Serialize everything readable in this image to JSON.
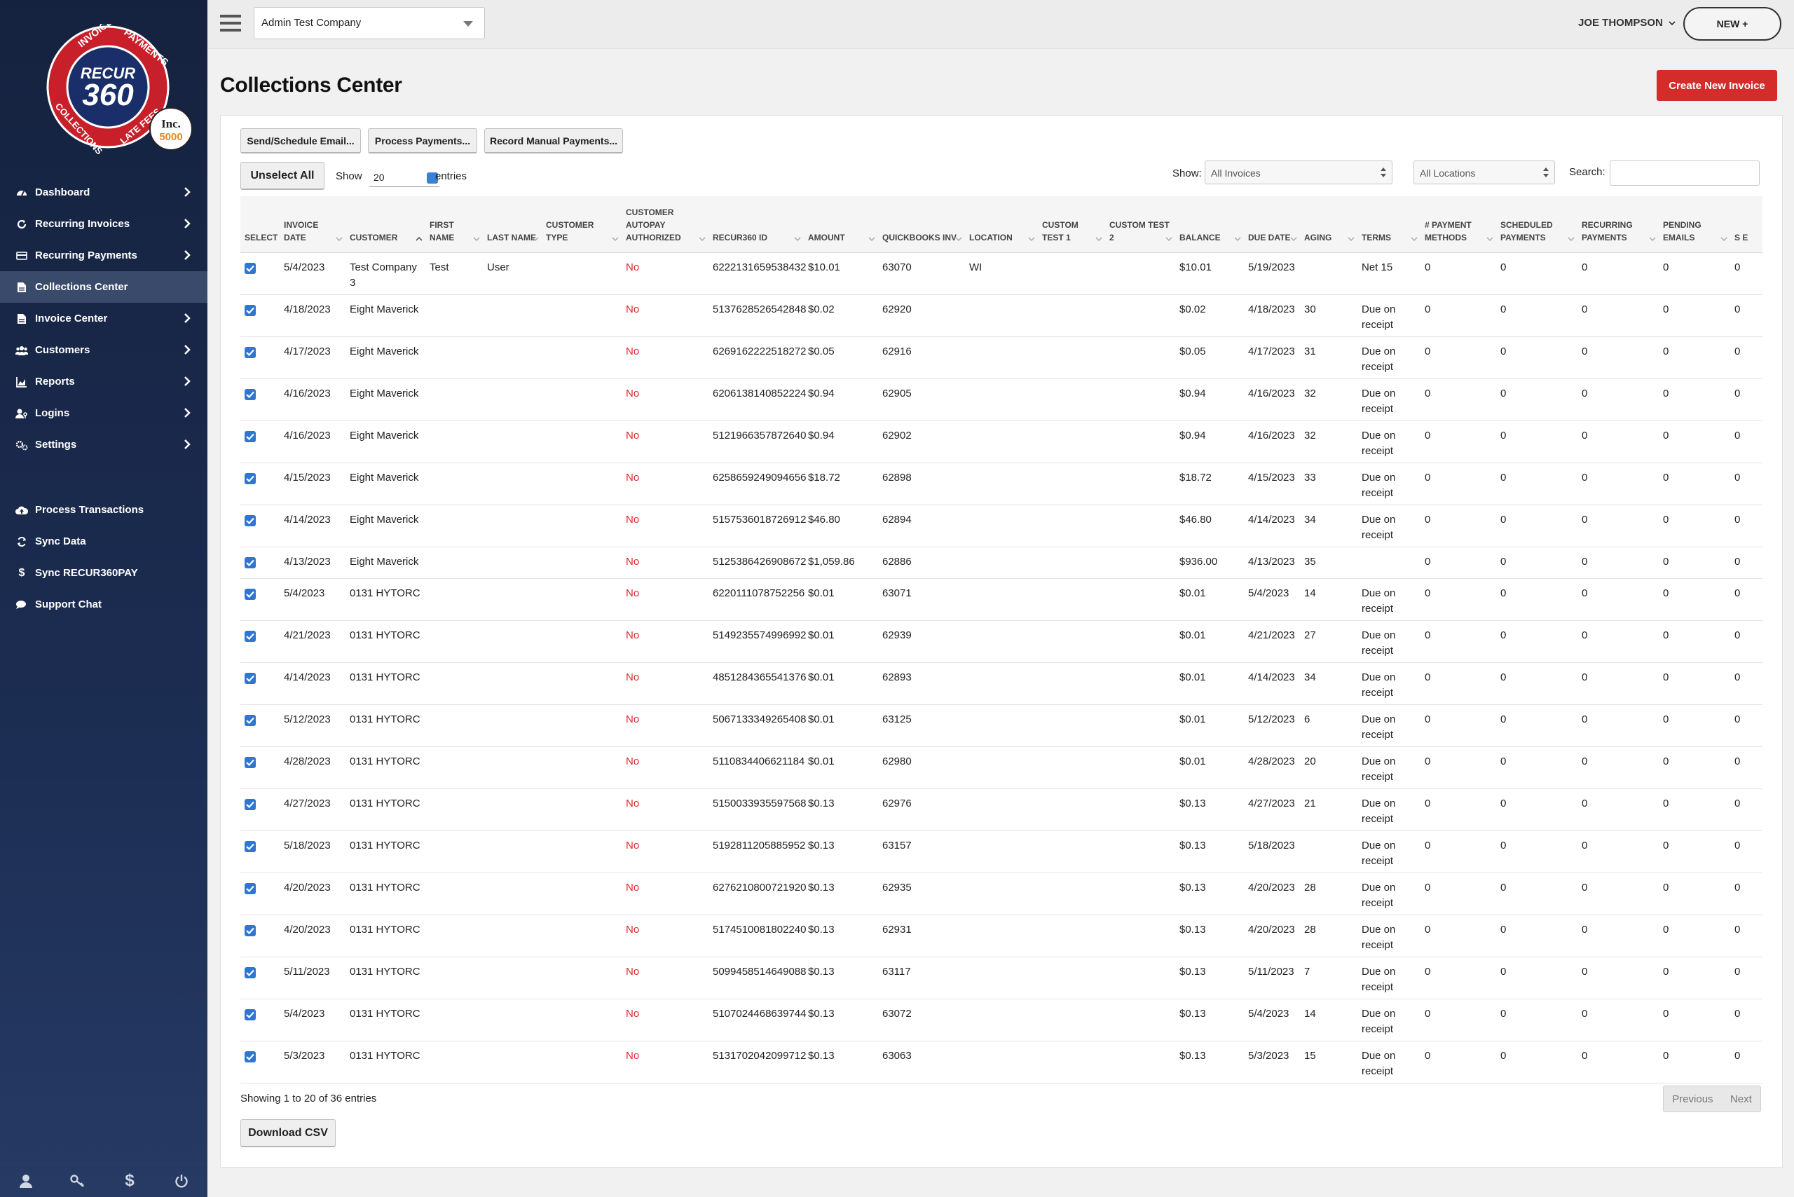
{
  "brand": {
    "logo_text_main": "RECUR",
    "logo_text_num": "360",
    "ring_words": [
      "INVOICES",
      "PAYMENTS",
      "LATE FEES",
      "COLLECTIONS"
    ],
    "badge_line1": "Inc.",
    "badge_line2": "5000"
  },
  "sidebar": {
    "items": [
      {
        "label": "Dashboard",
        "icon": "dashboard-icon",
        "chevron": true
      },
      {
        "label": "Recurring Invoices",
        "icon": "refresh-icon",
        "chevron": true
      },
      {
        "label": "Recurring Payments",
        "icon": "credit-card-icon",
        "chevron": true
      },
      {
        "label": "Collections Center",
        "icon": "file-icon",
        "chevron": false,
        "active": true
      },
      {
        "label": "Invoice Center",
        "icon": "file-icon",
        "chevron": true
      },
      {
        "label": "Customers",
        "icon": "users-icon",
        "chevron": true
      },
      {
        "label": "Reports",
        "icon": "chart-icon",
        "chevron": true
      },
      {
        "label": "Logins",
        "icon": "user-key-icon",
        "chevron": true
      },
      {
        "label": "Settings",
        "icon": "gears-icon",
        "chevron": true
      }
    ],
    "secondary": [
      {
        "label": "Process Transactions",
        "icon": "cloud-upload-icon"
      },
      {
        "label": "Sync Data",
        "icon": "sync-icon"
      },
      {
        "label": "Sync RECUR360PAY",
        "icon": "dollar-icon"
      },
      {
        "label": "Support Chat",
        "icon": "chat-icon"
      }
    ],
    "footer_icons": [
      "user-icon",
      "key-icon",
      "dollar-icon",
      "power-icon"
    ]
  },
  "topbar": {
    "company": "Admin Test Company",
    "user": "JOE THOMPSON",
    "new_label": "NEW +"
  },
  "page": {
    "title": "Collections Center",
    "create_label": "Create New Invoice"
  },
  "toolbar": {
    "send_email": "Send/Schedule Email...",
    "process_payments": "Process Payments...",
    "record_manual": "Record Manual Payments...",
    "unselect_all": "Unselect All",
    "show": "Show",
    "entries_value": "20",
    "entries": "entries",
    "show_filter_label": "Show:",
    "invoice_filter": "All Invoices",
    "location_filter": "All Locations",
    "search_label": "Search:"
  },
  "table": {
    "headers": [
      "SELECT",
      "INVOICE DATE",
      "CUSTOMER",
      "FIRST NAME",
      "LAST NAME",
      "CUSTOMER TYPE",
      "CUSTOMER AUTOPAY AUTHORIZED",
      "RECUR360 ID",
      "AMOUNT",
      "QUICKBOOKS INV",
      "LOCATION",
      "CUSTOM TEST 1",
      "CUSTOM TEST 2",
      "BALANCE",
      "DUE DATE",
      "AGING",
      "TERMS",
      "# PAYMENT METHODS",
      "SCHEDULED PAYMENTS",
      "RECURRING PAYMENTS",
      "PENDING EMAILS",
      "S E"
    ],
    "rows": [
      {
        "date": "5/4/2023",
        "customer": "Test Company 3",
        "first": "Test",
        "last": "User",
        "ctype": "",
        "autopay": "No",
        "id": "6222131659538432",
        "amount": "$10.01",
        "qb": "63070",
        "location": "WI",
        "c1": "",
        "c2": "",
        "balance": "$10.01",
        "due": "5/19/2023",
        "aging": "",
        "terms": "Net 15",
        "pm": "0",
        "sp": "0",
        "rp": "0",
        "pe": "0",
        "se": "0"
      },
      {
        "date": "4/18/2023",
        "customer": "Eight Maverick",
        "first": "",
        "last": "",
        "ctype": "",
        "autopay": "No",
        "id": "5137628526542848",
        "amount": "$0.02",
        "qb": "62920",
        "location": "",
        "c1": "",
        "c2": "",
        "balance": "$0.02",
        "due": "4/18/2023",
        "aging": "30",
        "terms": "Due on receipt",
        "pm": "0",
        "sp": "0",
        "rp": "0",
        "pe": "0",
        "se": "0"
      },
      {
        "date": "4/17/2023",
        "customer": "Eight Maverick",
        "first": "",
        "last": "",
        "ctype": "",
        "autopay": "No",
        "id": "6269162222518272",
        "amount": "$0.05",
        "qb": "62916",
        "location": "",
        "c1": "",
        "c2": "",
        "balance": "$0.05",
        "due": "4/17/2023",
        "aging": "31",
        "terms": "Due on receipt",
        "pm": "0",
        "sp": "0",
        "rp": "0",
        "pe": "0",
        "se": "0"
      },
      {
        "date": "4/16/2023",
        "customer": "Eight Maverick",
        "first": "",
        "last": "",
        "ctype": "",
        "autopay": "No",
        "id": "6206138140852224",
        "amount": "$0.94",
        "qb": "62905",
        "location": "",
        "c1": "",
        "c2": "",
        "balance": "$0.94",
        "due": "4/16/2023",
        "aging": "32",
        "terms": "Due on receipt",
        "pm": "0",
        "sp": "0",
        "rp": "0",
        "pe": "0",
        "se": "0"
      },
      {
        "date": "4/16/2023",
        "customer": "Eight Maverick",
        "first": "",
        "last": "",
        "ctype": "",
        "autopay": "No",
        "id": "5121966357872640",
        "amount": "$0.94",
        "qb": "62902",
        "location": "",
        "c1": "",
        "c2": "",
        "balance": "$0.94",
        "due": "4/16/2023",
        "aging": "32",
        "terms": "Due on receipt",
        "pm": "0",
        "sp": "0",
        "rp": "0",
        "pe": "0",
        "se": "0"
      },
      {
        "date": "4/15/2023",
        "customer": "Eight Maverick",
        "first": "",
        "last": "",
        "ctype": "",
        "autopay": "No",
        "id": "6258659249094656",
        "amount": "$18.72",
        "qb": "62898",
        "location": "",
        "c1": "",
        "c2": "",
        "balance": "$18.72",
        "due": "4/15/2023",
        "aging": "33",
        "terms": "Due on receipt",
        "pm": "0",
        "sp": "0",
        "rp": "0",
        "pe": "0",
        "se": "0"
      },
      {
        "date": "4/14/2023",
        "customer": "Eight Maverick",
        "first": "",
        "last": "",
        "ctype": "",
        "autopay": "No",
        "id": "5157536018726912",
        "amount": "$46.80",
        "qb": "62894",
        "location": "",
        "c1": "",
        "c2": "",
        "balance": "$46.80",
        "due": "4/14/2023",
        "aging": "34",
        "terms": "Due on receipt",
        "pm": "0",
        "sp": "0",
        "rp": "0",
        "pe": "0",
        "se": "0"
      },
      {
        "date": "4/13/2023",
        "customer": "Eight Maverick",
        "first": "",
        "last": "",
        "ctype": "",
        "autopay": "No",
        "id": "5125386426908672",
        "amount": "$1,059.86",
        "qb": "62886",
        "location": "",
        "c1": "",
        "c2": "",
        "balance": "$936.00",
        "due": "4/13/2023",
        "aging": "35",
        "terms": "",
        "pm": "0",
        "sp": "0",
        "rp": "0",
        "pe": "0",
        "se": "0"
      },
      {
        "date": "5/4/2023",
        "customer": "0131 HYTORC",
        "first": "",
        "last": "",
        "ctype": "",
        "autopay": "No",
        "id": "6220111078752256",
        "amount": "$0.01",
        "qb": "63071",
        "location": "",
        "c1": "",
        "c2": "",
        "balance": "$0.01",
        "due": "5/4/2023",
        "aging": "14",
        "terms": "Due on receipt",
        "pm": "0",
        "sp": "0",
        "rp": "0",
        "pe": "0",
        "se": "0"
      },
      {
        "date": "4/21/2023",
        "customer": "0131 HYTORC",
        "first": "",
        "last": "",
        "ctype": "",
        "autopay": "No",
        "id": "5149235574996992",
        "amount": "$0.01",
        "qb": "62939",
        "location": "",
        "c1": "",
        "c2": "",
        "balance": "$0.01",
        "due": "4/21/2023",
        "aging": "27",
        "terms": "Due on receipt",
        "pm": "0",
        "sp": "0",
        "rp": "0",
        "pe": "0",
        "se": "0"
      },
      {
        "date": "4/14/2023",
        "customer": "0131 HYTORC",
        "first": "",
        "last": "",
        "ctype": "",
        "autopay": "No",
        "id": "4851284365541376",
        "amount": "$0.01",
        "qb": "62893",
        "location": "",
        "c1": "",
        "c2": "",
        "balance": "$0.01",
        "due": "4/14/2023",
        "aging": "34",
        "terms": "Due on receipt",
        "pm": "0",
        "sp": "0",
        "rp": "0",
        "pe": "0",
        "se": "0"
      },
      {
        "date": "5/12/2023",
        "customer": "0131 HYTORC",
        "first": "",
        "last": "",
        "ctype": "",
        "autopay": "No",
        "id": "5067133349265408",
        "amount": "$0.01",
        "qb": "63125",
        "location": "",
        "c1": "",
        "c2": "",
        "balance": "$0.01",
        "due": "5/12/2023",
        "aging": "6",
        "terms": "Due on receipt",
        "pm": "0",
        "sp": "0",
        "rp": "0",
        "pe": "0",
        "se": "0"
      },
      {
        "date": "4/28/2023",
        "customer": "0131 HYTORC",
        "first": "",
        "last": "",
        "ctype": "",
        "autopay": "No",
        "id": "5110834406621184",
        "amount": "$0.01",
        "qb": "62980",
        "location": "",
        "c1": "",
        "c2": "",
        "balance": "$0.01",
        "due": "4/28/2023",
        "aging": "20",
        "terms": "Due on receipt",
        "pm": "0",
        "sp": "0",
        "rp": "0",
        "pe": "0",
        "se": "0"
      },
      {
        "date": "4/27/2023",
        "customer": "0131 HYTORC",
        "first": "",
        "last": "",
        "ctype": "",
        "autopay": "No",
        "id": "5150033935597568",
        "amount": "$0.13",
        "qb": "62976",
        "location": "",
        "c1": "",
        "c2": "",
        "balance": "$0.13",
        "due": "4/27/2023",
        "aging": "21",
        "terms": "Due on receipt",
        "pm": "0",
        "sp": "0",
        "rp": "0",
        "pe": "0",
        "se": "0"
      },
      {
        "date": "5/18/2023",
        "customer": "0131 HYTORC",
        "first": "",
        "last": "",
        "ctype": "",
        "autopay": "No",
        "id": "5192811205885952",
        "amount": "$0.13",
        "qb": "63157",
        "location": "",
        "c1": "",
        "c2": "",
        "balance": "$0.13",
        "due": "5/18/2023",
        "aging": "",
        "terms": "Due on receipt",
        "pm": "0",
        "sp": "0",
        "rp": "0",
        "pe": "0",
        "se": "0"
      },
      {
        "date": "4/20/2023",
        "customer": "0131 HYTORC",
        "first": "",
        "last": "",
        "ctype": "",
        "autopay": "No",
        "id": "6276210800721920",
        "amount": "$0.13",
        "qb": "62935",
        "location": "",
        "c1": "",
        "c2": "",
        "balance": "$0.13",
        "due": "4/20/2023",
        "aging": "28",
        "terms": "Due on receipt",
        "pm": "0",
        "sp": "0",
        "rp": "0",
        "pe": "0",
        "se": "0"
      },
      {
        "date": "4/20/2023",
        "customer": "0131 HYTORC",
        "first": "",
        "last": "",
        "ctype": "",
        "autopay": "No",
        "id": "5174510081802240",
        "amount": "$0.13",
        "qb": "62931",
        "location": "",
        "c1": "",
        "c2": "",
        "balance": "$0.13",
        "due": "4/20/2023",
        "aging": "28",
        "terms": "Due on receipt",
        "pm": "0",
        "sp": "0",
        "rp": "0",
        "pe": "0",
        "se": "0"
      },
      {
        "date": "5/11/2023",
        "customer": "0131 HYTORC",
        "first": "",
        "last": "",
        "ctype": "",
        "autopay": "No",
        "id": "5099458514649088",
        "amount": "$0.13",
        "qb": "63117",
        "location": "",
        "c1": "",
        "c2": "",
        "balance": "$0.13",
        "due": "5/11/2023",
        "aging": "7",
        "terms": "Due on receipt",
        "pm": "0",
        "sp": "0",
        "rp": "0",
        "pe": "0",
        "se": "0"
      },
      {
        "date": "5/4/2023",
        "customer": "0131 HYTORC",
        "first": "",
        "last": "",
        "ctype": "",
        "autopay": "No",
        "id": "5107024468639744",
        "amount": "$0.13",
        "qb": "63072",
        "location": "",
        "c1": "",
        "c2": "",
        "balance": "$0.13",
        "due": "5/4/2023",
        "aging": "14",
        "terms": "Due on receipt",
        "pm": "0",
        "sp": "0",
        "rp": "0",
        "pe": "0",
        "se": "0"
      },
      {
        "date": "5/3/2023",
        "customer": "0131 HYTORC",
        "first": "",
        "last": "",
        "ctype": "",
        "autopay": "No",
        "id": "5131702042099712",
        "amount": "$0.13",
        "qb": "63063",
        "location": "",
        "c1": "",
        "c2": "",
        "balance": "$0.13",
        "due": "5/3/2023",
        "aging": "15",
        "terms": "Due on receipt",
        "pm": "0",
        "sp": "0",
        "rp": "0",
        "pe": "0",
        "se": "0"
      }
    ]
  },
  "footer": {
    "showing": "Showing 1 to 20 of 36 entries",
    "previous": "Previous",
    "next": "Next",
    "download": "Download CSV"
  },
  "colors": {
    "accent_red": "#d42b2b",
    "sidebar_bg": "#15223f",
    "checkbox_blue": "#2f76d2"
  }
}
